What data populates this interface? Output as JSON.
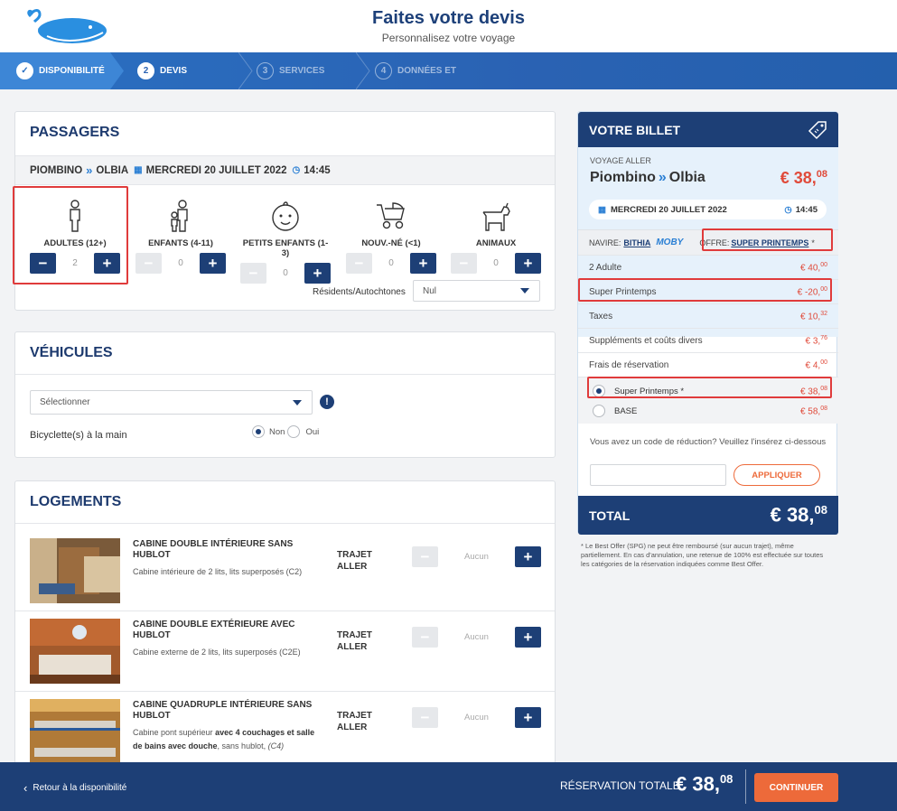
{
  "header": {
    "title": "Faites votre devis",
    "subtitle": "Personnalisez votre voyage"
  },
  "steps": [
    {
      "num": "1",
      "label": "DISPONIBILITÉ"
    },
    {
      "num": "2",
      "label": "DEVIS"
    },
    {
      "num": "3",
      "label": "SERVICES"
    },
    {
      "num": "4",
      "label": "DONNÉES ET"
    }
  ],
  "passengers": {
    "title": "PASSAGERS",
    "route_from": "PIOMBINO",
    "route_to": "OLBIA",
    "date": "MERCREDI 20 JUILLET 2022",
    "time": "14:45",
    "types": [
      {
        "label": "ADULTES (12+)",
        "value": "2"
      },
      {
        "label": "ENFANTS (4-11)",
        "value": "0"
      },
      {
        "label": "PETITS ENFANTS (1-3)",
        "value": "0"
      },
      {
        "label": "NOUV.-NÉ (<1)",
        "value": "0"
      },
      {
        "label": "ANIMAUX",
        "value": "0"
      }
    ],
    "residents_label": "Résidents/Autochtones",
    "residents_value": "Nul"
  },
  "vehicles": {
    "title": "VÉHICULES",
    "select_value": "Sélectionner",
    "bicycle_label": "Bicyclette(s) à la main",
    "no_label": "Non",
    "yes_label": "Oui"
  },
  "cabins": {
    "title": "LOGEMENTS",
    "items": [
      {
        "name": "CABINE DOUBLE INTÉRIEURE SANS HUBLOT",
        "desc": "Cabine intérieure de 2 lits, lits superposés (C2)",
        "trajet": "TRAJET ALLER",
        "value": "Aucun"
      },
      {
        "name": "CABINE DOUBLE EXTÉRIEURE AVEC HUBLOT",
        "desc": "Cabine externe de 2 lits, lits superposés (C2E)",
        "trajet": "TRAJET ALLER",
        "value": "Aucun"
      },
      {
        "name": "CABINE QUADRUPLE INTÉRIEURE SANS HUBLOT",
        "desc_a": "Cabine pont supérieur ",
        "desc_b": "avec 4 couchages et salle de bains avec douche",
        "desc_c": ", sans hublot, ",
        "desc_d": "(C4)",
        "trajet": "TRAJET ALLER",
        "value": "Aucun"
      }
    ]
  },
  "ticket": {
    "title": "VOTRE BILLET",
    "voyage_label": "VOYAGE ALLER",
    "from": "Piombino",
    "to": "Olbia",
    "price_int": "€ 38,",
    "price_dec": "08",
    "date": "MERCREDI 20 JUILLET 2022",
    "time": "14:45",
    "ship_label": "NAVIRE:",
    "ship_name": "BITHIA",
    "ship_brand": "MOBY",
    "offer_label": "OFFRE:",
    "offer_name": "SUPER PRINTEMPS",
    "offer_star": "*",
    "lines": [
      {
        "label": "2 Adulte",
        "int": "€ 40,",
        "dec": "00"
      },
      {
        "label": "Super Printemps",
        "int": "€ -20,",
        "dec": "00"
      },
      {
        "label": "Taxes",
        "int": "€ 10,",
        "dec": "32"
      },
      {
        "label": "Suppléments et coûts divers",
        "int": "€ 3,",
        "dec": "76"
      },
      {
        "label": "Frais de réservation",
        "int": "€ 4,",
        "dec": "00"
      }
    ],
    "fares": [
      {
        "label": "Super Printemps *",
        "int": "€ 38,",
        "dec": "08"
      },
      {
        "label": "BASE",
        "int": "€ 58,",
        "dec": "08"
      }
    ],
    "promo_text": "Vous avez un code de réduction? Veuillez l'insérez ci-dessous",
    "apply_label": "APPLIQUER",
    "total_label": "TOTAL",
    "total_int": "€ 38,",
    "total_dec": "08"
  },
  "footnote": "* Le Best Offer (SPG) ne peut être remboursé (sur aucun trajet), même partiellement. En cas d'annulation, une retenue de 100% est effectuée sur toutes les catégories de la réservation indiquées comme Best Offer.",
  "bottom": {
    "back_label": "Retour à la disponibilité",
    "total_label": "RÉSERVATION TOTALE",
    "total_int": "€ 38,",
    "total_dec": "08",
    "continue_label": "CONTINUER"
  },
  "colors": {
    "navy": "#1d3f76",
    "accent_blue": "#2a7fd4",
    "price_red": "#e04a3a",
    "orange": "#ed6a3a",
    "highlight_red": "#e03b3b"
  }
}
